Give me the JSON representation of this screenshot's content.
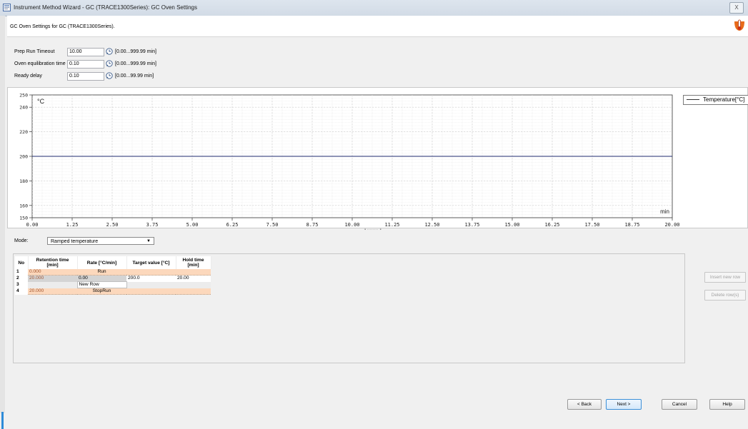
{
  "window": {
    "title": "Instrument Method Wizard - GC (TRACE1300Series): GC Oven Settings",
    "close_glyph": "X"
  },
  "header": {
    "text": "GC Oven Settings for GC (TRACE1300Series)."
  },
  "settings": [
    {
      "label": "Prep Run Timeout",
      "value": "10.00",
      "range": "[0.00...999.99 min]"
    },
    {
      "label": "Oven equilibration time",
      "value": "0.10",
      "range": "[0.00...999.99 min]"
    },
    {
      "label": "Ready delay",
      "value": "0.10",
      "range": "[0.00...99.99 min]"
    }
  ],
  "chart_data": {
    "type": "line",
    "title": "",
    "xlabel": "min",
    "ylabel": "°C",
    "xlim": [
      0,
      20
    ],
    "ylim": [
      150,
      250
    ],
    "x_ticks": [
      "0.00",
      "1.25",
      "2.50",
      "3.75",
      "5.00",
      "6.25",
      "7.50",
      "8.75",
      "10.00",
      "11.25",
      "12.50",
      "13.75",
      "15.00",
      "16.25",
      "17.50",
      "18.75",
      "20.00"
    ],
    "y_ticks": [
      150,
      160,
      180,
      200,
      220,
      240,
      250
    ],
    "grid": true,
    "legend": "right",
    "series": [
      {
        "name": "Temperature[°C]",
        "x": [
          0,
          20
        ],
        "y": [
          200,
          200
        ],
        "color": "#1f2a6e"
      }
    ]
  },
  "mode": {
    "label": "Mode:",
    "value": "Ramped temperature"
  },
  "table": {
    "headers": [
      "No",
      "Retention time [min]",
      "Rate [°C/min]",
      "Target value [°C]",
      "Hold time [min]"
    ],
    "rows": [
      {
        "no": "1",
        "retention": "0.000",
        "rate": "Run",
        "target": "",
        "hold": ""
      },
      {
        "no": "2",
        "retention": "20.000",
        "rate": "0.00",
        "target": "200.0",
        "hold": "20.00"
      },
      {
        "no": "3",
        "retention": "",
        "rate": "New Row",
        "target": "",
        "hold": ""
      },
      {
        "no": "4",
        "retention": "20.000",
        "rate": "StopRun",
        "target": "",
        "hold": ""
      }
    ]
  },
  "side_buttons": {
    "insert": "Insert new row",
    "delete": "Delete row(s)"
  },
  "nav": {
    "back": "< Back",
    "next": "Next >",
    "cancel": "Cancel",
    "help": "Help"
  },
  "colors": {
    "series": "#1f2a6e",
    "peach": "#fcd8bc",
    "accent": "#3b8fd8"
  }
}
